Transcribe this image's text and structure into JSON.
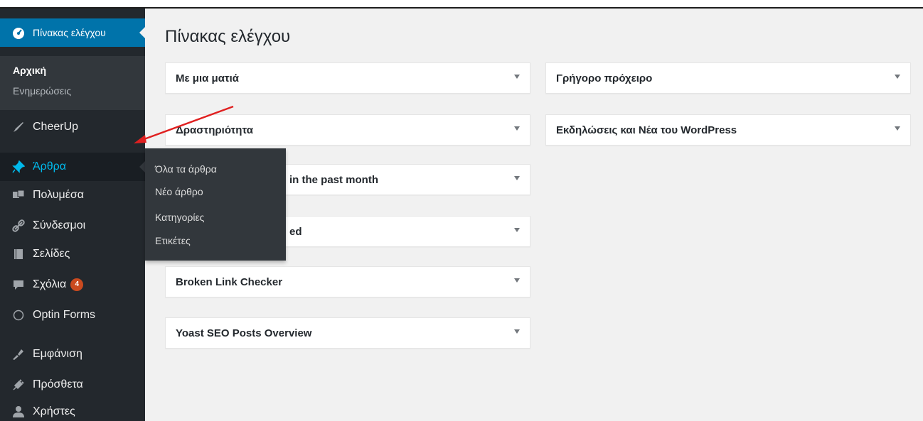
{
  "sidebar": {
    "dashboard_label": "Πίνακας ελέγχου",
    "submenu": {
      "home": "Αρχική",
      "updates": "Ενημερώσεις"
    },
    "items": [
      {
        "label": "CheerUp",
        "icon": "brush-icon"
      },
      {
        "label": "Άρθρα",
        "icon": "pin-icon"
      },
      {
        "label": "Πολυμέσα",
        "icon": "media-icon"
      },
      {
        "label": "Σύνδεσμοι",
        "icon": "link-icon"
      },
      {
        "label": "Σελίδες",
        "icon": "pages-icon"
      },
      {
        "label": "Σχόλια",
        "icon": "comment-icon",
        "badge": "4"
      },
      {
        "label": "Optin Forms",
        "icon": "circle-icon"
      },
      {
        "label": "Εμφάνιση",
        "icon": "appearance-icon"
      },
      {
        "label": "Πρόσθετα",
        "icon": "plugins-icon"
      },
      {
        "label": "Χρήστες",
        "icon": "users-icon"
      }
    ]
  },
  "flyout": {
    "items": [
      "Όλα τα άρθρα",
      "Νέο άρθρο",
      "Κατηγορίες",
      "Ετικέτες"
    ]
  },
  "main": {
    "title": "Πίνακας ελέγχου",
    "left_widgets": [
      "Με μια ματιά",
      "Δραστηριότητα",
      "in the past month",
      "ed",
      "Broken Link Checker",
      "Yoast SEO Posts Overview"
    ],
    "right_widgets": [
      "Γρήγορο πρόχειρο",
      "Εκδηλώσεις και Νέα του WordPress"
    ]
  },
  "colors": {
    "sidebar_bg": "#23282d",
    "active_blue": "#0073aa",
    "hover_text": "#00b9eb",
    "badge": "#ca4a1f",
    "annotation_arrow": "#e02020"
  }
}
